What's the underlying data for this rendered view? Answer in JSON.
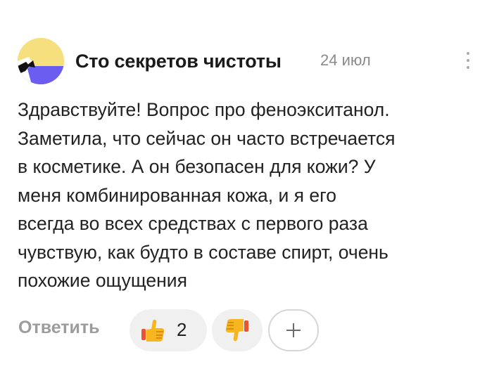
{
  "comment": {
    "author": "Сто секретов чистоты",
    "date": "24 июл",
    "text_lines": [
      "Здравствуйте! Вопрос про феноэкситанол.",
      "Заметила, что сейчас он часто встречается",
      "в косметике. А он безопасен для кожи? У",
      "меня комбинированная кожа, и я его",
      "всегда во всех средствах с первого раза",
      "чувствую, как будто в составе спирт, очень",
      "похожие ощущения"
    ]
  },
  "actions": {
    "reply_label": "Ответить",
    "like_count": "2",
    "like_icon": "thumbs-up-icon",
    "dislike_icon": "thumbs-down-icon",
    "add_reaction_icon": "plus-icon",
    "more_icon": "more-vertical-icon"
  },
  "colors": {
    "avatar_yellow": "#f6df7d",
    "avatar_purple": "#6a5df0",
    "reply_gray": "#9c9c9c",
    "pill_bg": "#f0f0f0"
  }
}
